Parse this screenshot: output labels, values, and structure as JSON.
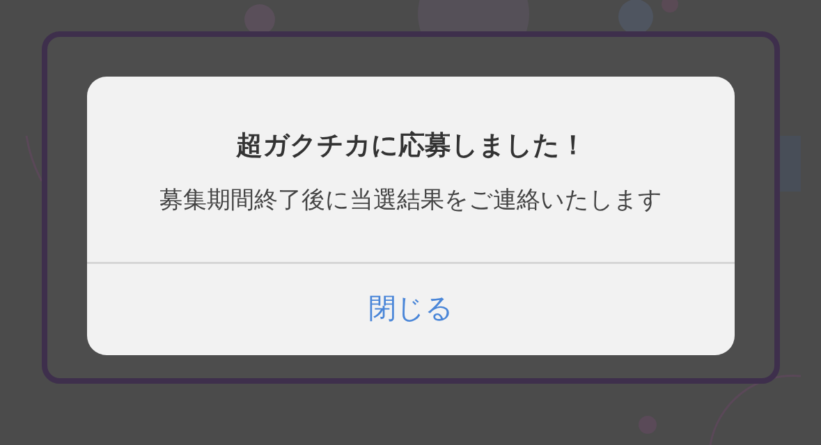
{
  "dialog": {
    "title": "超ガクチカに応募しました！",
    "message": "募集期間終了後に当選結果をご連絡いたします",
    "buttons": [
      "閉じる"
    ]
  }
}
